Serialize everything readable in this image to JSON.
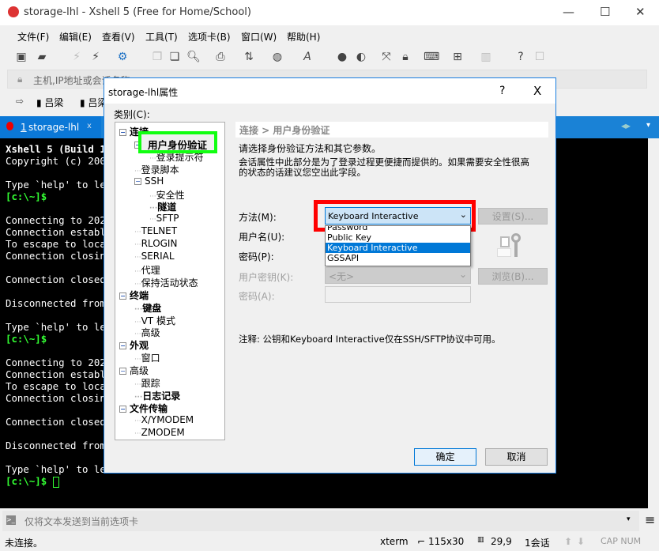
{
  "window": {
    "title": "storage-lhl - Xshell 5 (Free for Home/School)",
    "minimize": "—",
    "maximize": "☐",
    "close": "✕"
  },
  "menu": [
    "文件(F)",
    "编辑(E)",
    "查看(V)",
    "工具(T)",
    "选项卡(B)",
    "窗口(W)",
    "帮助(H)"
  ],
  "toolbar_icons": [
    "new-session-icon",
    "open-folder-icon",
    "disconnect-icon",
    "reconnect-icon",
    "properties-icon",
    "copy-icon",
    "paste-icon",
    "find-icon",
    "print-icon",
    "transfer-icon",
    "globe-icon",
    "font-icon",
    "xftp-icon",
    "xmanager-icon",
    "fullscreen-icon",
    "lock-icon",
    "keyboard-icon",
    "new-tab-icon",
    "layout-icon",
    "help-icon",
    "chat-icon"
  ],
  "address": {
    "placeholder": "主机,IP地址或会话名称"
  },
  "bookmarks": [
    "吕梁",
    "吕梁"
  ],
  "tabs": [
    {
      "number": "1",
      "label": "storage-lhl",
      "close": "x"
    }
  ],
  "terminal": {
    "lines": [
      {
        "t": "Xshell 5 (Build 13",
        "c": "b"
      },
      {
        "t": "Copyright (c) 2002",
        "c": ""
      },
      {
        "t": "",
        "c": ""
      },
      {
        "t": "Type `help' to lea",
        "c": ""
      },
      {
        "t": "[c:\\~]$",
        "c": "g"
      },
      {
        "t": "",
        "c": ""
      },
      {
        "t": "Connecting to 202.",
        "c": ""
      },
      {
        "t": "Connection establi",
        "c": ""
      },
      {
        "t": "To escape to local",
        "c": ""
      },
      {
        "t": "Connection closing",
        "c": ""
      },
      {
        "t": "",
        "c": ""
      },
      {
        "t": "Connection closed ",
        "c": ""
      },
      {
        "t": "",
        "c": ""
      },
      {
        "t": "Disconnected from ",
        "c": ""
      },
      {
        "t": "",
        "c": ""
      },
      {
        "t": "Type `help' to lea",
        "c": ""
      },
      {
        "t": "[c:\\~]$",
        "c": "g"
      },
      {
        "t": "",
        "c": ""
      },
      {
        "t": "Connecting to 202.",
        "c": ""
      },
      {
        "t": "Connection establi",
        "c": ""
      },
      {
        "t": "To escape to local",
        "c": ""
      },
      {
        "t": "Connection closing",
        "c": ""
      },
      {
        "t": "",
        "c": ""
      },
      {
        "t": "Connection closed ",
        "c": ""
      },
      {
        "t": "",
        "c": ""
      },
      {
        "t": "Disconnected from ",
        "c": ""
      },
      {
        "t": "",
        "c": ""
      },
      {
        "t": "Type `help' to lea",
        "c": ""
      }
    ],
    "prompt": "[c:\\~]$ "
  },
  "sendbar": {
    "placeholder": "仅将文本发送到当前选项卡"
  },
  "status": {
    "text": "未连接。",
    "term": "xterm",
    "size": "115x30",
    "pos": "29,9",
    "sessions": "1会话",
    "caps": "CAP NUM"
  },
  "dialog": {
    "title": "storage-lhl属性",
    "help": "?",
    "close": "X",
    "category_label": "类别(C):",
    "tree": [
      {
        "label": "连接",
        "level": 0,
        "bold": true,
        "exp": "−"
      },
      {
        "label": "用户身份验证",
        "level": 1,
        "bold": true,
        "exp": "−"
      },
      {
        "label": "登录提示符",
        "level": 2,
        "bold": false
      },
      {
        "label": "登录脚本",
        "level": 1,
        "bold": false
      },
      {
        "label": "SSH",
        "level": 1,
        "bold": false,
        "exp": "−"
      },
      {
        "label": "安全性",
        "level": 2,
        "bold": false
      },
      {
        "label": "隧道",
        "level": 2,
        "bold": true
      },
      {
        "label": "SFTP",
        "level": 2,
        "bold": false
      },
      {
        "label": "TELNET",
        "level": 1,
        "bold": false
      },
      {
        "label": "RLOGIN",
        "level": 1,
        "bold": false
      },
      {
        "label": "SERIAL",
        "level": 1,
        "bold": false
      },
      {
        "label": "代理",
        "level": 1,
        "bold": false
      },
      {
        "label": "保持活动状态",
        "level": 1,
        "bold": false
      },
      {
        "label": "终端",
        "level": 0,
        "bold": true,
        "exp": "−"
      },
      {
        "label": "键盘",
        "level": 1,
        "bold": true
      },
      {
        "label": "VT 模式",
        "level": 1,
        "bold": false
      },
      {
        "label": "高级",
        "level": 1,
        "bold": false
      },
      {
        "label": "外观",
        "level": 0,
        "bold": true,
        "exp": "−"
      },
      {
        "label": "窗口",
        "level": 1,
        "bold": false
      },
      {
        "label": "高级",
        "level": 0,
        "bold": false,
        "exp": "−"
      },
      {
        "label": "跟踪",
        "level": 1,
        "bold": false
      },
      {
        "label": "日志记录",
        "level": 1,
        "bold": true
      },
      {
        "label": "文件传输",
        "level": 0,
        "bold": true,
        "exp": "−"
      },
      {
        "label": "X/YMODEM",
        "level": 1,
        "bold": false
      },
      {
        "label": "ZMODEM",
        "level": 1,
        "bold": false
      }
    ],
    "selected_tree_item": "用户身份验证",
    "breadcrumb": "连接 > 用户身份验证",
    "desc1": "请选择身份验证方法和其它参数。",
    "desc2": "会话属性中此部分是为了登录过程更便捷而提供的。如果需要安全性很高",
    "desc3": "的状态的话建议您空出此字段。",
    "method_label": "方法(M):",
    "method_value": "Keyboard Interactive",
    "method_options": [
      "Password",
      "Public Key",
      "Keyboard Interactive",
      "GSSAPI"
    ],
    "settings_button": "设置(S)...",
    "username_label": "用户名(U):",
    "password_label": "密码(P):",
    "userkey_label": "用户密钥(K):",
    "userkey_value": "<无>",
    "browse_button": "浏览(B)...",
    "passphrase_label": "密码(A):",
    "note": "注释: 公钥和Keyboard Interactive仅在SSH/SFTP协议中可用。",
    "ok": "确定",
    "cancel": "取消"
  }
}
